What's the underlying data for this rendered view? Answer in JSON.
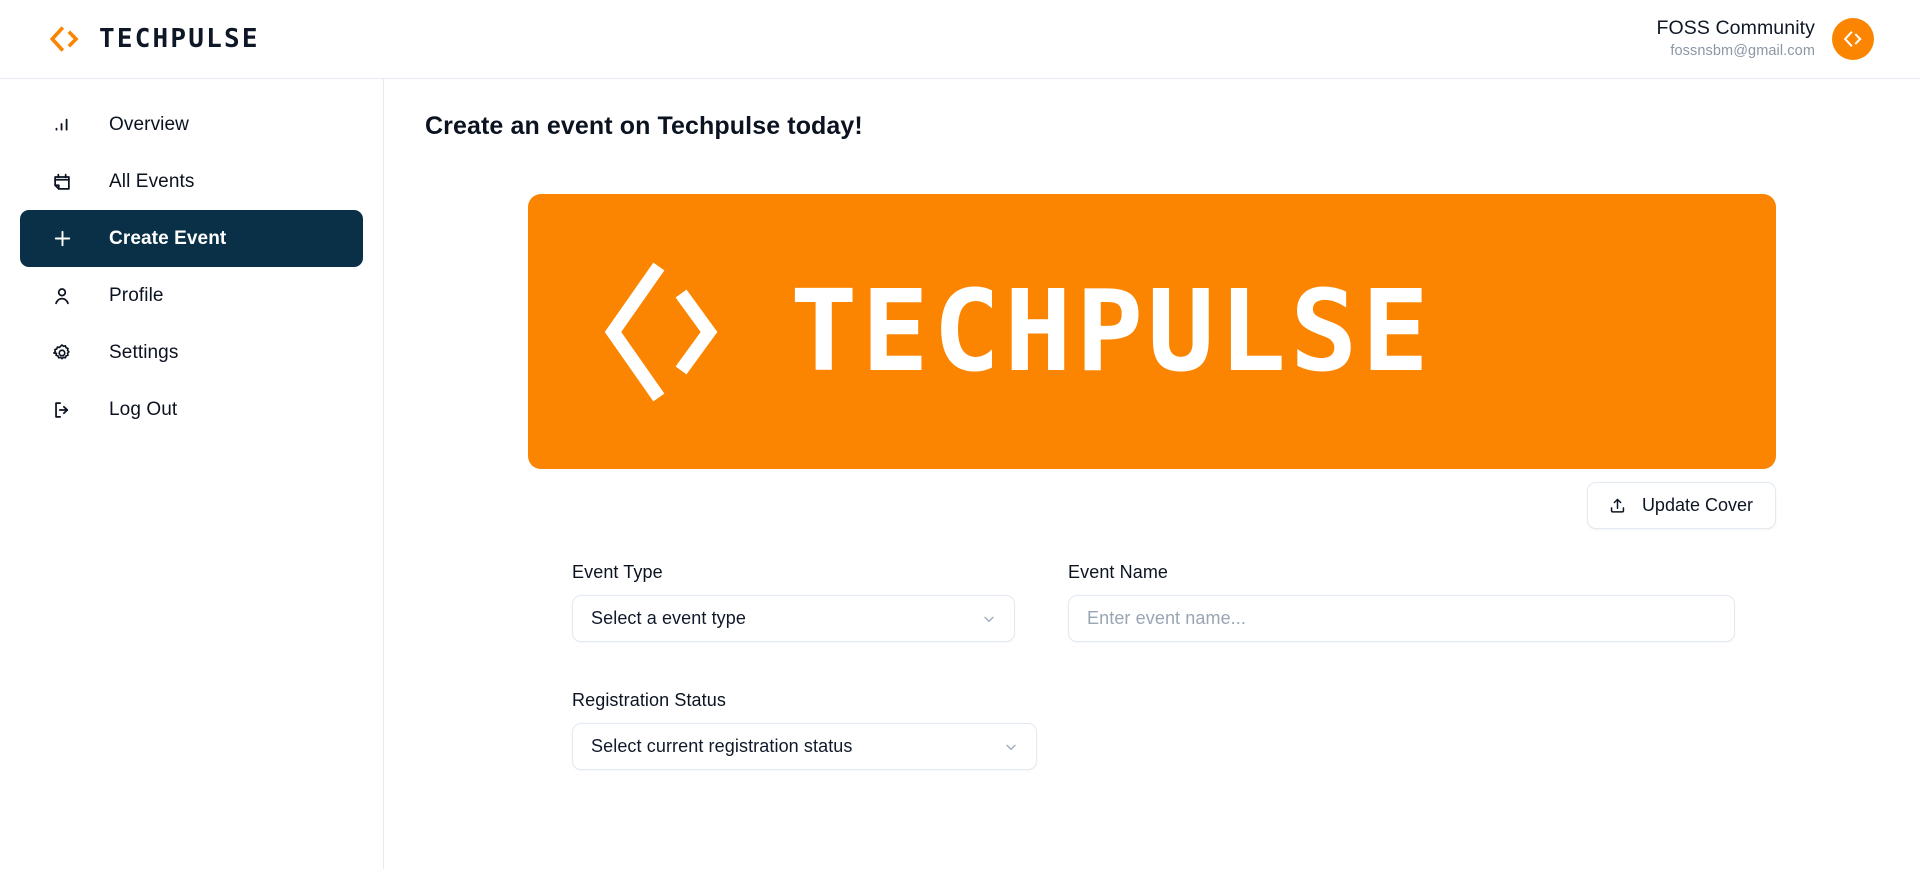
{
  "brand": {
    "name": "TECHPULSE",
    "logo_icon": "code-brackets-icon",
    "accent_color": "#fb8500"
  },
  "header": {
    "account": {
      "name": "FOSS Community",
      "email": "fossnsbm@gmail.com",
      "avatar_icon": "code-brackets-icon"
    }
  },
  "sidebar": {
    "items": [
      {
        "id": "overview",
        "label": "Overview",
        "icon": "bar-chart-icon",
        "active": false
      },
      {
        "id": "all-events",
        "label": "All Events",
        "icon": "calendar-icon",
        "active": false
      },
      {
        "id": "create-event",
        "label": "Create Event",
        "icon": "plus-icon",
        "active": true
      },
      {
        "id": "profile",
        "label": "Profile",
        "icon": "user-icon",
        "active": false
      },
      {
        "id": "settings",
        "label": "Settings",
        "icon": "gear-icon",
        "active": false
      },
      {
        "id": "log-out",
        "label": "Log Out",
        "icon": "logout-icon",
        "active": false
      }
    ],
    "active_bg": "#0a3048"
  },
  "main": {
    "page_title": "Create an event on Techpulse today!",
    "cover": {
      "wordmark": "TECHPULSE",
      "icon": "code-brackets-icon",
      "background_color": "#fb8500"
    },
    "update_cover": {
      "label": "Update Cover",
      "icon": "upload-icon"
    },
    "form": {
      "event_type": {
        "label": "Event Type",
        "value": "Select a event type",
        "icon": "chevron-down-icon"
      },
      "event_name": {
        "label": "Event Name",
        "placeholder": "Enter event name...",
        "value": ""
      },
      "registration_status": {
        "label": "Registration Status",
        "value": "Select current registration status",
        "icon": "chevron-down-icon"
      }
    }
  }
}
